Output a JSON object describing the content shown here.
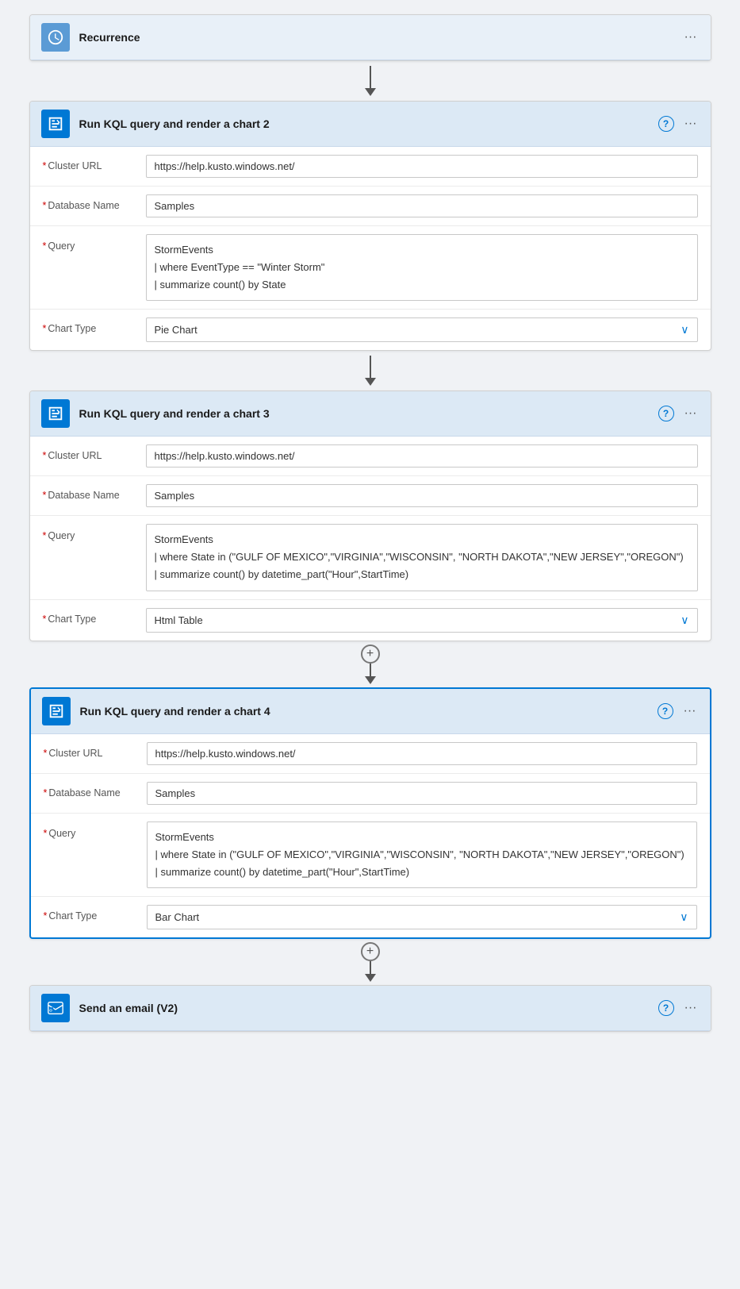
{
  "recurrence": {
    "title": "Recurrence",
    "icon": "clock"
  },
  "card2": {
    "title": "Run KQL query and render a chart 2",
    "cluster_url_label": "* Cluster URL",
    "cluster_url_value": "https://help.kusto.windows.net/",
    "database_name_label": "* Database Name",
    "database_name_value": "Samples",
    "query_label": "* Query",
    "query_line1": "StormEvents",
    "query_line2": "| where EventType == \"Winter Storm\"",
    "query_line3": "| summarize count() by State",
    "chart_type_label": "* Chart Type",
    "chart_type_value": "Pie Chart"
  },
  "card3": {
    "title": "Run KQL query and render a chart 3",
    "cluster_url_label": "* Cluster URL",
    "cluster_url_value": "https://help.kusto.windows.net/",
    "database_name_label": "* Database Name",
    "database_name_value": "Samples",
    "query_label": "* Query",
    "query_line1": "StormEvents",
    "query_line2": "| where State in (\"GULF OF MEXICO\",\"VIRGINIA\",\"WISCONSIN\", \"NORTH DAKOTA\",\"NEW JERSEY\",\"OREGON\")",
    "query_line3": "| summarize count() by datetime_part(\"Hour\",StartTime)",
    "chart_type_label": "* Chart Type",
    "chart_type_value": "Html Table"
  },
  "card4": {
    "title": "Run KQL query and render a chart 4",
    "cluster_url_label": "* Cluster URL",
    "cluster_url_value": "https://help.kusto.windows.net/",
    "database_name_label": "* Database Name",
    "database_name_value": "Samples",
    "query_label": "* Query",
    "query_line1": "StormEvents",
    "query_line2": "| where State in (\"GULF OF MEXICO\",\"VIRGINIA\",\"WISCONSIN\", \"NORTH DAKOTA\",\"NEW JERSEY\",\"OREGON\")",
    "query_line3": "| summarize count() by datetime_part(\"Hour\",StartTime)",
    "chart_type_label": "* Chart Type",
    "chart_type_value": "Bar Chart"
  },
  "email_card": {
    "title": "Send an email (V2)"
  },
  "labels": {
    "required_star": "*",
    "cluster_url": "Cluster URL",
    "database_name": "Database Name",
    "query": "Query",
    "chart_type": "Chart Type"
  },
  "icons": {
    "more": "···",
    "question_mark": "?",
    "chevron_down": "∨",
    "plus": "+",
    "arrow": "↓"
  }
}
